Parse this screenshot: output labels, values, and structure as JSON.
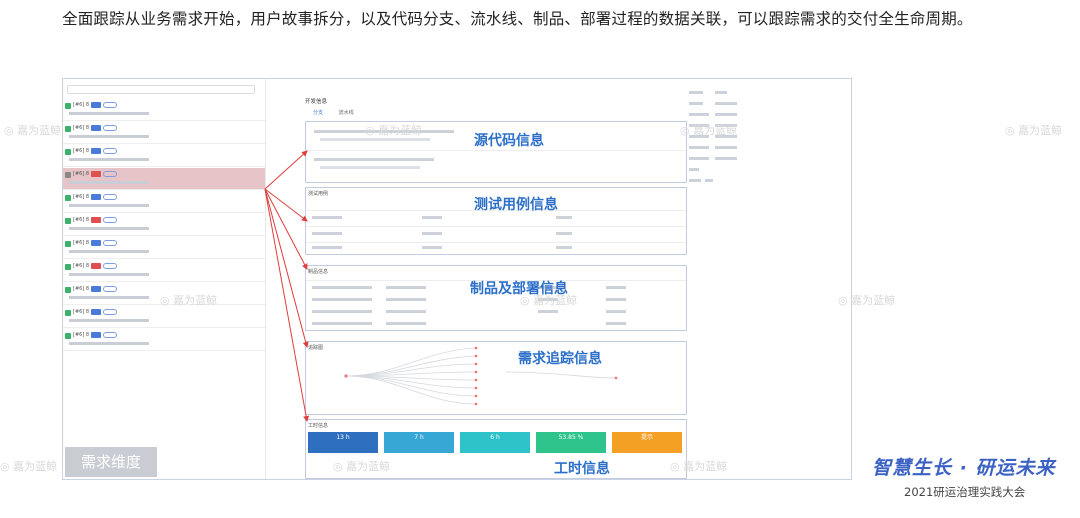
{
  "heading": "全面跟踪从业务需求开始，用户故事拆分，以及代码分支、流水线、制品、部署过程的数据关联，可以跟踪需求的交付全生命周期。",
  "annotations": {
    "source_code": "源代码信息",
    "test_cases": "测试用例信息",
    "artifacts_deploy": "制品及部署信息",
    "requirement_trace": "需求追踪信息",
    "work_hours": "工时信息",
    "dimension": "需求维度"
  },
  "middle": {
    "title": "开发信息",
    "tabs": [
      "分支",
      "流水线"
    ],
    "test_title": "测试用例",
    "artifact_title": "制品信息",
    "trace_title": "追踪图",
    "hours_title": "工时信息"
  },
  "hours_tiles": [
    {
      "value": "13 h",
      "color": "#2f6fc0"
    },
    {
      "value": "7 h",
      "color": "#37a7d6"
    },
    {
      "value": "6 h",
      "color": "#2ec3c8"
    },
    {
      "value": "53.85 %",
      "color": "#2fc48c"
    },
    {
      "value": "提示",
      "color": "#f3a024"
    }
  ],
  "stories": [
    {
      "id": "[#6] 8",
      "tag": "blue",
      "highlight": false
    },
    {
      "id": "[#6] 8",
      "tag": "blue",
      "highlight": false
    },
    {
      "id": "[#6] 8",
      "tag": "blue",
      "highlight": false
    },
    {
      "id": "[#6] 8",
      "tag": "red",
      "highlight": true
    },
    {
      "id": "[#6] 8",
      "tag": "blue",
      "highlight": false
    },
    {
      "id": "[#6] 8",
      "tag": "red",
      "highlight": false
    },
    {
      "id": "[#6] 8",
      "tag": "blue",
      "highlight": false
    },
    {
      "id": "[#6] 8",
      "tag": "red",
      "highlight": false
    },
    {
      "id": "[#6] 8",
      "tag": "blue",
      "highlight": false
    },
    {
      "id": "[#6] 8",
      "tag": "blue",
      "highlight": false
    },
    {
      "id": "[#6] 8",
      "tag": "blue",
      "highlight": false
    }
  ],
  "slogan": "智慧生长 · 研运未来",
  "conference": "2021研运治理实践大会",
  "colors": {
    "accent": "#2c6fc9",
    "arrow": "#e03c3c",
    "slogan": "#3c62c4"
  }
}
